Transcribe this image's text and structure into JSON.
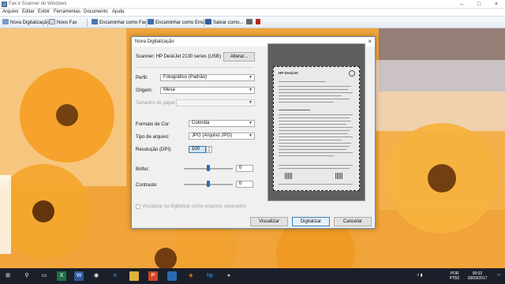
{
  "window": {
    "title": "Fax e Scanner do Windows"
  },
  "menu": [
    "Arquivo",
    "Editar",
    "Exibir",
    "Ferramentas",
    "Documento",
    "Ajuda"
  ],
  "toolbar": {
    "new_scan": "Nova Digitalização",
    "new_fax": "Novo Fax",
    "forward_fax": "Encaminhar como Fax",
    "forward_email": "Encaminhar como Email",
    "save_as": "Salvar como..."
  },
  "dialog": {
    "title": "Nova Digitalização",
    "scanner_label": "Scanner: HP DeskJet 2130 series (USB)",
    "change_button": "Alterar...",
    "profile_label": "Perfil:",
    "profile_value": "Fotográfico (Padrão)",
    "source_label": "Origem:",
    "source_value": "Mesa",
    "paper_size_label": "Tamanho do papel:",
    "paper_size_value": "",
    "color_format_label": "Formato de Cor:",
    "color_format_value": "Colorida",
    "file_type_label": "Tipo de arquivo:",
    "file_type_value": "JPG (Arquivo JPG)",
    "resolution_label": "Resolução (DPI):",
    "resolution_value": "100",
    "brightness_label": "Brilho:",
    "brightness_value": "0",
    "contrast_label": "Contraste:",
    "contrast_value": "0",
    "preview_checkbox_label": "Visualizar ou digitalizar como arquivos separados",
    "preview_button": "Visualizar",
    "scan_button": "Digitalizar",
    "cancel_button": "Cancelar",
    "brightness_level": 0.5,
    "contrast_level": 0.5
  },
  "preview_doc": {
    "brand": "HP DeskJet"
  },
  "taskbar": {
    "lang": "POR",
    "layout": "PTB2",
    "time": "00:02",
    "date": "18/09/2017"
  },
  "colors": {
    "accent": "#1f6fc5",
    "taskbar": "#1b1f2a",
    "photo_orange": "#f29d2f"
  }
}
